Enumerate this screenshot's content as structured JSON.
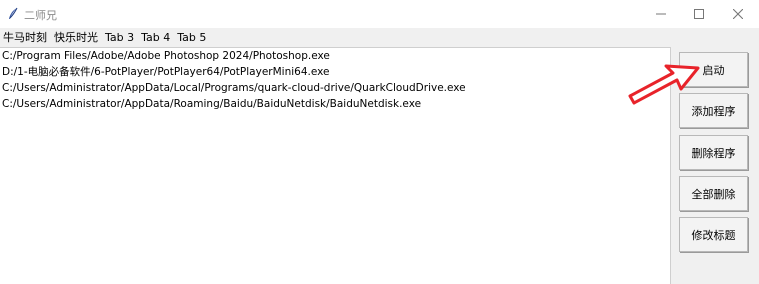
{
  "window": {
    "title": "二师兄"
  },
  "tabs": [
    {
      "label": "牛马时刻"
    },
    {
      "label": "快乐时光"
    },
    {
      "label": "Tab 3"
    },
    {
      "label": "Tab 4"
    },
    {
      "label": "Tab 5"
    }
  ],
  "programs": [
    "C:/Program Files/Adobe/Adobe Photoshop 2024/Photoshop.exe",
    "D:/1-电脑必备软件/6-PotPlayer/PotPlayer64/PotPlayerMini64.exe",
    "C:/Users/Administrator/AppData/Local/Programs/quark-cloud-drive/QuarkCloudDrive.exe",
    "C:/Users/Administrator/AppData/Roaming/Baidu/BaiduNetdisk/BaiduNetdisk.exe"
  ],
  "buttons": {
    "launch": "启动",
    "add_program": "添加程序",
    "delete_program": "删除程序",
    "delete_all": "全部删除",
    "edit_title": "修改标题"
  },
  "colors": {
    "annotation_arrow": "#e8232a"
  }
}
